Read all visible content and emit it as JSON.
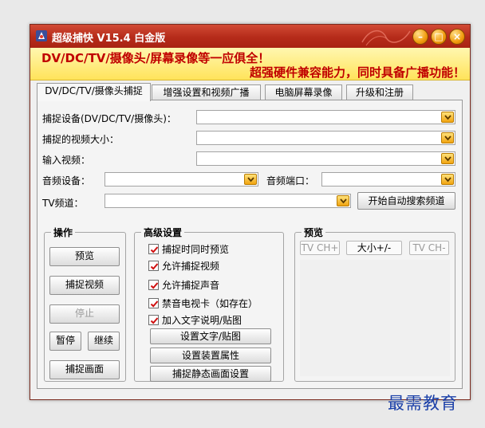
{
  "window": {
    "title": "超级捕快 V15.4 白金版",
    "min_label": "–",
    "max_label": "□",
    "close_label": "×"
  },
  "banner": {
    "line1": "DV/DC/TV/摄像头/屏幕录像等一应俱全！",
    "line2": "超强硬件兼容能力，同时具备广播功能！"
  },
  "tabs": [
    {
      "label": "DV/DC/TV/摄像头捕捉",
      "active": true
    },
    {
      "label": "增强设置和视频广播",
      "active": false
    },
    {
      "label": "电脑屏幕录像",
      "active": false
    },
    {
      "label": "升级和注册",
      "active": false
    }
  ],
  "form": {
    "capture_device_label": "捕捉设备(DV/DC/TV/摄像头)：",
    "video_size_label": "捕捉的视频大小：",
    "input_video_label": "输入视频：",
    "audio_device_label": "音频设备：",
    "audio_port_label": "音频端口：",
    "tv_channel_label": "TV频道：",
    "auto_search_label": "开始自动搜索频道"
  },
  "operations": {
    "title": "操作",
    "preview": "预览",
    "capture_video": "捕捉视频",
    "stop": "停止",
    "pause": "暂停",
    "resume": "继续",
    "capture_frame": "捕捉画面"
  },
  "advanced": {
    "title": "高级设置",
    "options": [
      {
        "label": "捕捉时同时预览",
        "checked": true
      },
      {
        "label": "允许捕捉视频",
        "checked": true
      },
      {
        "label": "允许捕捉声音",
        "checked": true
      },
      {
        "label": "禁音电视卡（如存在）",
        "checked": true
      },
      {
        "label": "加入文字说明/贴图",
        "checked": true
      }
    ],
    "set_text": "设置文字/贴图",
    "device_props": "设置装置属性",
    "still_settings": "捕捉静态画面设置"
  },
  "preview_box": {
    "title": "预览",
    "ch_up": "TV CH+",
    "size": "大小+/-",
    "ch_down": "TV CH-"
  },
  "watermark": "最需教育",
  "colors": {
    "title_red": "#b52b1a",
    "banner_text": "#c00000",
    "accent_orange": "#f1a410"
  }
}
